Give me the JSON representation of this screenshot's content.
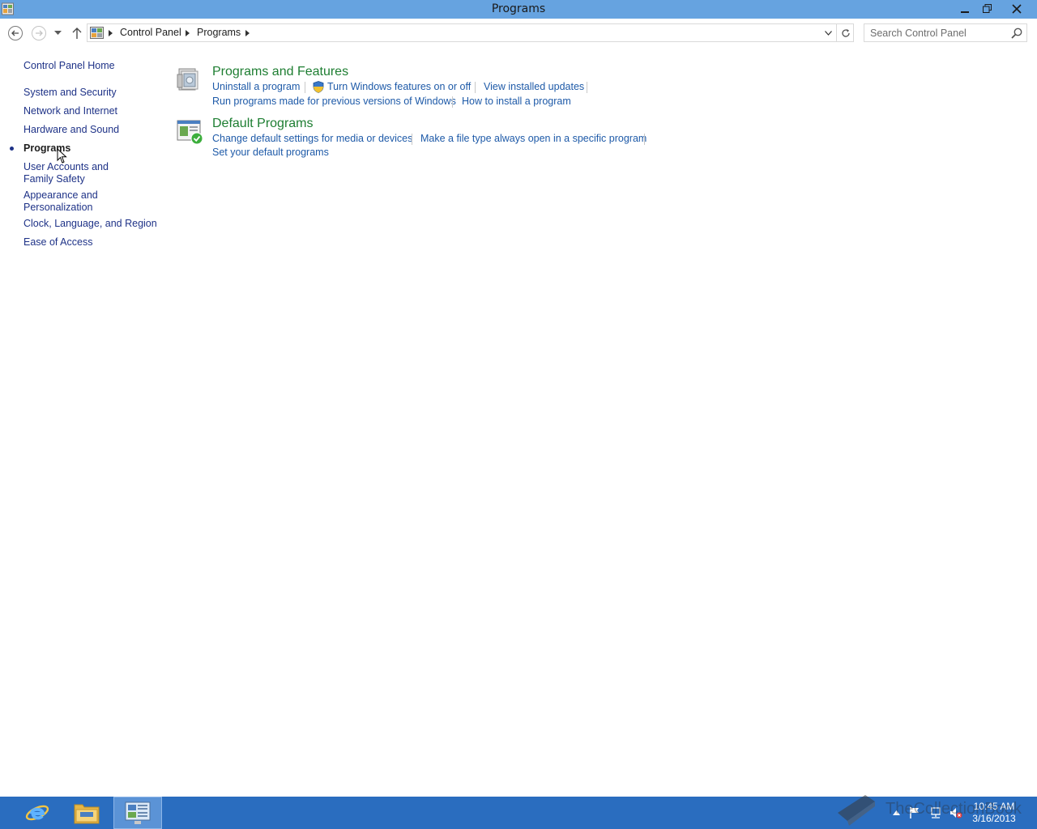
{
  "window": {
    "title": "Programs",
    "minimize_icon": "minimize-icon",
    "restore_icon": "restore-icon",
    "close_icon": "close-icon",
    "title_bar_color": "#66a3e0"
  },
  "navigation": {
    "back_icon": "back-arrow-icon",
    "forward_icon": "forward-arrow-icon",
    "recent_icon": "chevron-down-icon",
    "up_icon": "up-arrow-icon"
  },
  "address_bar": {
    "root_icon": "control-panel-icon",
    "breadcrumbs": [
      "Control Panel",
      "Programs"
    ]
  },
  "search": {
    "placeholder": "Search Control Panel"
  },
  "left_nav": {
    "home": "Control Panel Home",
    "items": [
      "System and Security",
      "Network and Internet",
      "Hardware and Sound",
      "Programs",
      "User Accounts and Family Safety",
      "Appearance and Personalization",
      "Clock, Language, and Region",
      "Ease of Access"
    ],
    "active": "Programs"
  },
  "categories": [
    {
      "title": "Programs and Features",
      "icon": "programs-and-features-icon",
      "links": [
        "Uninstall a program",
        "Turn Windows features on or off",
        "View installed updates",
        "Run programs made for previous versions of Windows",
        "How to install a program"
      ],
      "shield_link": "Turn Windows features on or off"
    },
    {
      "title": "Default Programs",
      "icon": "default-programs-icon",
      "links": [
        "Change default settings for media or devices",
        "Make a file type always open in a specific program",
        "Set your default programs"
      ]
    }
  ],
  "taskbar": {
    "apps": [
      "internet-explorer-icon",
      "file-explorer-icon",
      "control-panel-icon"
    ],
    "active_app": "control-panel-icon",
    "tray_icons": [
      "show-hidden-icons-icon",
      "action-center-flag-icon",
      "network-icon",
      "volume-muted-icon"
    ],
    "time": "10:45 AM",
    "date": "3/16/2013",
    "color": "#2a6dbf"
  },
  "watermark": {
    "text": "TheCollectionBook",
    "icon": "book-icon"
  }
}
